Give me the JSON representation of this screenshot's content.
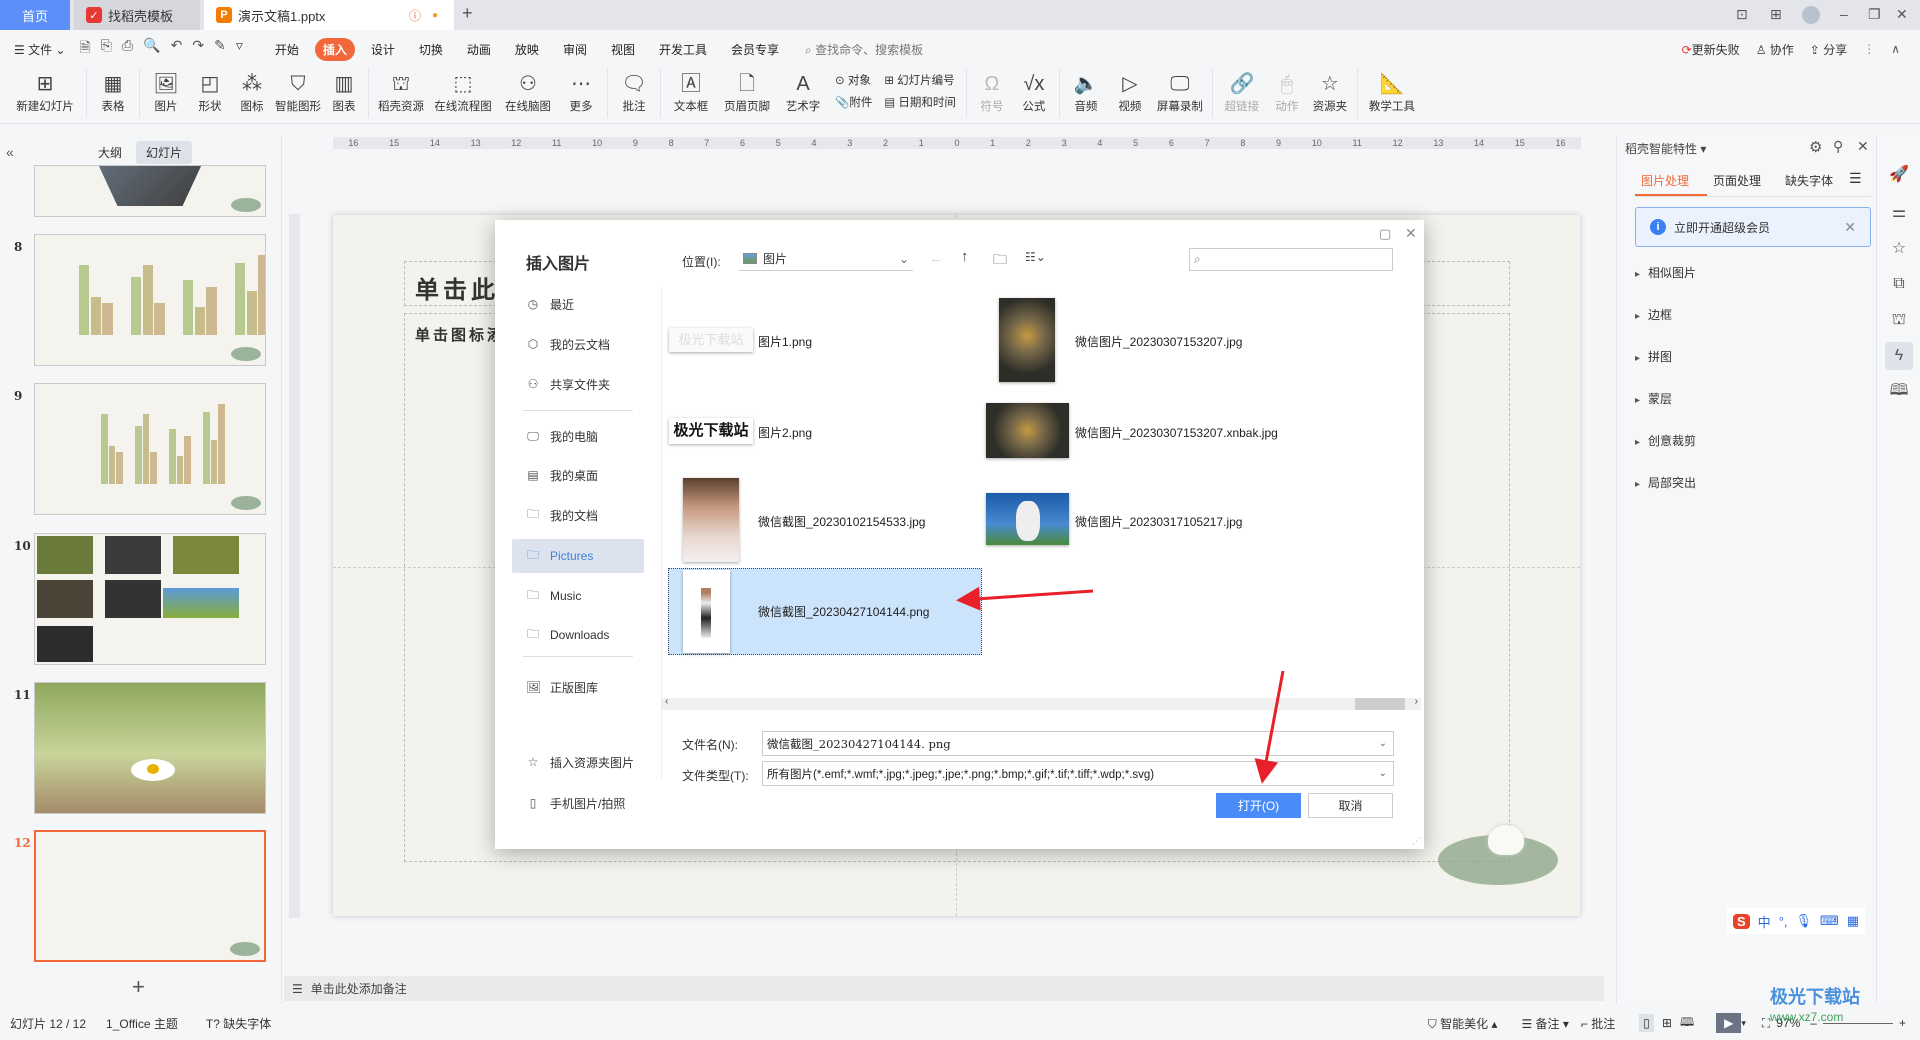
{
  "tabs": {
    "home": "首页",
    "template": "找稻壳模板",
    "doc": "演示文稿1.pptx"
  },
  "menu": {
    "file": "文件",
    "items": [
      "开始",
      "插入",
      "设计",
      "切换",
      "动画",
      "放映",
      "审阅",
      "视图",
      "开发工具",
      "会员专享"
    ],
    "active": "插入",
    "search": "查找命令、搜索模板",
    "update": "更新失败",
    "collab": "协作",
    "share": "分享"
  },
  "ribbon": {
    "new_slide": "新建幻灯片",
    "table": "表格",
    "picture": "图片",
    "shape": "形状",
    "icon": "图标",
    "smart_art": "智能图形",
    "chart": "图表",
    "docer": "稻壳资源",
    "flowchart": "在线流程图",
    "mindmap": "在线脑图",
    "more": "更多",
    "comment": "批注",
    "textbox": "文本框",
    "header_footer": "页眉页脚",
    "wordart": "艺术字",
    "object": "对象",
    "attachment": "附件",
    "slide_number": "幻灯片编号",
    "datetime": "日期和时间",
    "symbol": "符号",
    "formula": "公式",
    "audio": "音频",
    "video": "视频",
    "screen_record": "屏幕录制",
    "hyperlink": "超链接",
    "action": "动作",
    "resource": "资源夹",
    "teaching": "教学工具"
  },
  "left_panel": {
    "tab_outline": "大纲",
    "tab_slides": "幻灯片",
    "slides": [
      "8",
      "9",
      "10",
      "11",
      "12"
    ],
    "selected": "12"
  },
  "ruler_labels": [
    "16",
    "15",
    "14",
    "13",
    "12",
    "11",
    "10",
    "9",
    "8",
    "7",
    "6",
    "5",
    "4",
    "3",
    "2",
    "1",
    "0",
    "1",
    "2",
    "3",
    "4",
    "5",
    "6",
    "7",
    "8",
    "9",
    "10",
    "11",
    "12",
    "13",
    "14",
    "15",
    "16"
  ],
  "slide": {
    "title_placeholder": "单击此处添加标题",
    "content_placeholder": "单击图标添加内容"
  },
  "notes": "单击此处添加备注",
  "status": {
    "slide_count": "幻灯片 12 / 12",
    "theme": "1_Office 主题",
    "missing_font": "缺失字体",
    "beautify": "智能美化",
    "notes": "备注",
    "comments": "批注",
    "zoom": "97%"
  },
  "right_panel": {
    "title": "稻壳智能特性",
    "tabs": [
      "图片处理",
      "页面处理",
      "缺失字体"
    ],
    "active_tab": "图片处理",
    "banner": "立即开通超级会员",
    "items": [
      "相似图片",
      "边框",
      "拼图",
      "蒙层",
      "创意裁剪",
      "局部突出"
    ]
  },
  "dialog": {
    "title": "插入图片",
    "location_label": "位置(I):",
    "location": "图片",
    "search_placeholder": "",
    "nav": [
      {
        "label": "最近",
        "icon": "clock-icon"
      },
      {
        "label": "我的云文档",
        "icon": "cloud-icon"
      },
      {
        "label": "共享文件夹",
        "icon": "share-icon"
      },
      {
        "label": "我的电脑",
        "icon": "computer-icon"
      },
      {
        "label": "我的桌面",
        "icon": "desktop-icon"
      },
      {
        "label": "我的文档",
        "icon": "folder-icon"
      },
      {
        "label": "Pictures",
        "icon": "folder-icon"
      },
      {
        "label": "Music",
        "icon": "folder-icon"
      },
      {
        "label": "Downloads",
        "icon": "folder-icon"
      },
      {
        "label": "正版图库",
        "icon": "gallery-icon"
      },
      {
        "label": "插入资源夹图片",
        "icon": "resource-icon"
      },
      {
        "label": "手机图片/拍照",
        "icon": "phone-icon"
      }
    ],
    "selected_nav": "Pictures",
    "files": [
      "图片1.png",
      "微信图片_20230307153207.jpg",
      "图片2.png",
      "微信图片_20230307153207.xnbak.jpg",
      "微信截图_20230102154533.jpg",
      "微信图片_20230317105217.jpg",
      "微信截图_20230427104144.png"
    ],
    "selected_file": "微信截图_20230427104144.png",
    "thumb_text": "极光下载站",
    "filename_label": "文件名(N):",
    "filename": "微信截图_20230427104144. png",
    "filetype_label": "文件类型(T):",
    "filetype": "所有图片(*.emf;*.wmf;*.jpg;*.jpeg;*.jpe;*.png;*.bmp;*.gif;*.tif;*.tiff;*.wdp;*.svg)",
    "open": "打开(O)",
    "cancel": "取消"
  },
  "ime": {
    "lang": "中",
    "punct": "°,"
  },
  "watermark": {
    "text": "极光下载站",
    "url": "www.xz7.com"
  },
  "colors": {
    "accent": "#f2683b",
    "primary": "#4a8cf7",
    "selected": "#cce4fb",
    "arrow": "#e8202a"
  }
}
